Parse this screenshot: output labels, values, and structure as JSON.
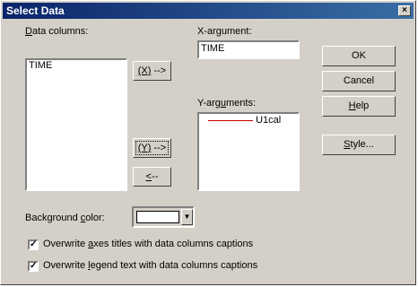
{
  "window": {
    "title": "Select Data",
    "close": "×"
  },
  "data_columns": {
    "label_pre": "",
    "label_u": "D",
    "label_post": "ata columns:",
    "items": [
      "TIME"
    ]
  },
  "x_argument": {
    "label_pre": "X-ar",
    "label_u": "g",
    "label_post": "ument:",
    "value": "TIME",
    "button_pre": "",
    "button_u": "(X)",
    "button_post": " -->"
  },
  "y_arguments": {
    "label_pre": "Y-arg",
    "label_u": "u",
    "label_post": "ments:",
    "items": [
      {
        "name": "U1cal",
        "color": "#cc0000"
      }
    ],
    "add_pre": "",
    "add_u": "(Y)",
    "add_post": " -->",
    "remove_u": "<",
    "remove_post": "--"
  },
  "buttons": {
    "ok": "OK",
    "cancel": "Cancel",
    "help_u": "H",
    "help_post": "elp",
    "style_u": "S",
    "style_post": "tyle..."
  },
  "background_color": {
    "label_pre": "Background ",
    "label_u": "c",
    "label_post": "olor:",
    "value": "#ffffff"
  },
  "checkboxes": [
    {
      "checked": true,
      "pre": "Overwrite ",
      "u": "a",
      "post": "xes titles with data columns captions"
    },
    {
      "checked": true,
      "pre": "Overwrite ",
      "u": "l",
      "post": "egend text with data columns captions"
    }
  ],
  "colors": {
    "dialog_bg": "#d4d0c8",
    "title_bg": "#0a246a"
  }
}
